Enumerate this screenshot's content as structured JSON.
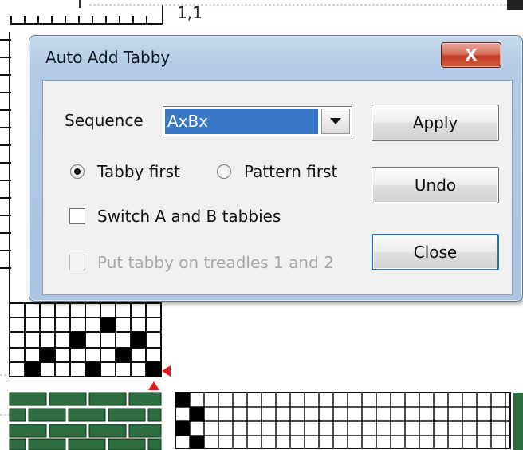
{
  "background": {
    "ruler_label": "1,1",
    "accent_color": "#e01a1a",
    "weave_green": "#2c6e3f"
  },
  "dialog": {
    "title": "Auto Add Tabby",
    "close_icon": "x-icon",
    "close_label": "X",
    "sequence": {
      "label": "Sequence",
      "selected": "AxBx",
      "dropdown_icon": "chevron-down-icon"
    },
    "radios": [
      {
        "label": "Tabby first",
        "selected": true
      },
      {
        "label": "Pattern first",
        "selected": false
      }
    ],
    "checkboxes": [
      {
        "label": "Switch A and B tabbies",
        "checked": false,
        "enabled": true
      },
      {
        "label": "Put tabby on treadles 1 and 2",
        "checked": false,
        "enabled": false
      }
    ],
    "buttons": {
      "apply": "Apply",
      "undo": "Undo",
      "close": "Close"
    }
  }
}
